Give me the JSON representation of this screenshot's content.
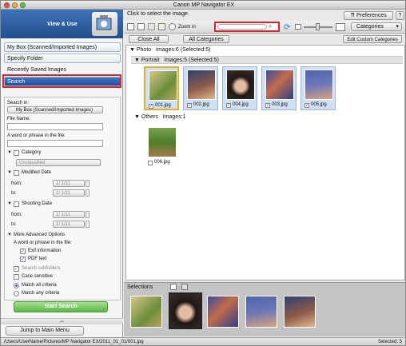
{
  "window": {
    "title": "Canon MP Navigator EX"
  },
  "left": {
    "view_use": "View & Use",
    "nav": [
      "My Box (Scanned/Imported Images)",
      "Specify Folder",
      "Recently Saved Images",
      "Search"
    ],
    "search": {
      "search_in_label": "Search in:",
      "search_in_value": "My Box (Scanned/Imported Images)",
      "file_name_label": "File Name:",
      "word_label": "A word or phrase in the file:",
      "category_label": "Category",
      "category_value": "Unclassified",
      "modified_label": "Modified Date",
      "from_label": "from:",
      "to_label": "to:",
      "date_value": "1/ 1/11",
      "shooting_label": "Shooting Date",
      "more_label": "More Advanced Options",
      "word_in_file": "A word or phrase in the file:",
      "exif_label": "Exif information",
      "pdf_label": "PDF text",
      "subfolders_label": "Search subfolders",
      "case_label": "Case sensitive",
      "match_all": "Match all criteria",
      "match_any": "Match any criteria"
    },
    "start_button": "Start Search",
    "jump_button": "Jump to Main Menu"
  },
  "right": {
    "hint": "Click to select the image.",
    "preferences": "Preferences",
    "help": "?",
    "zoom_in": "Zoom in",
    "category_select": "Categories",
    "close_all": "Close All",
    "all_categories": "All Categories",
    "edit_categories": "Edit Custom Categories",
    "photo_group": "Photo",
    "photo_count": "Images:6",
    "photo_selected": "(Selected:5)",
    "portrait_group": "Portrait",
    "portrait_count": "Images:5",
    "portrait_selected": "(Selected:5)",
    "others_group": "Others",
    "others_count": "Images:1",
    "portrait_files": [
      "001.jpg",
      "002.jpg",
      "004.jpg",
      "003.jpg",
      "005.jpg"
    ],
    "others_files": [
      "006.jpg"
    ],
    "selections_label": "Selections"
  },
  "status": {
    "path": "/Users/UserName/Pictures/MP Navigator EX/2011_01_01/001.jpg",
    "selected": "Selected: 5"
  },
  "colors": {
    "accent": "#d8242b",
    "start_button": "#5bb74a",
    "nav_selected": "#1f4f9e"
  }
}
